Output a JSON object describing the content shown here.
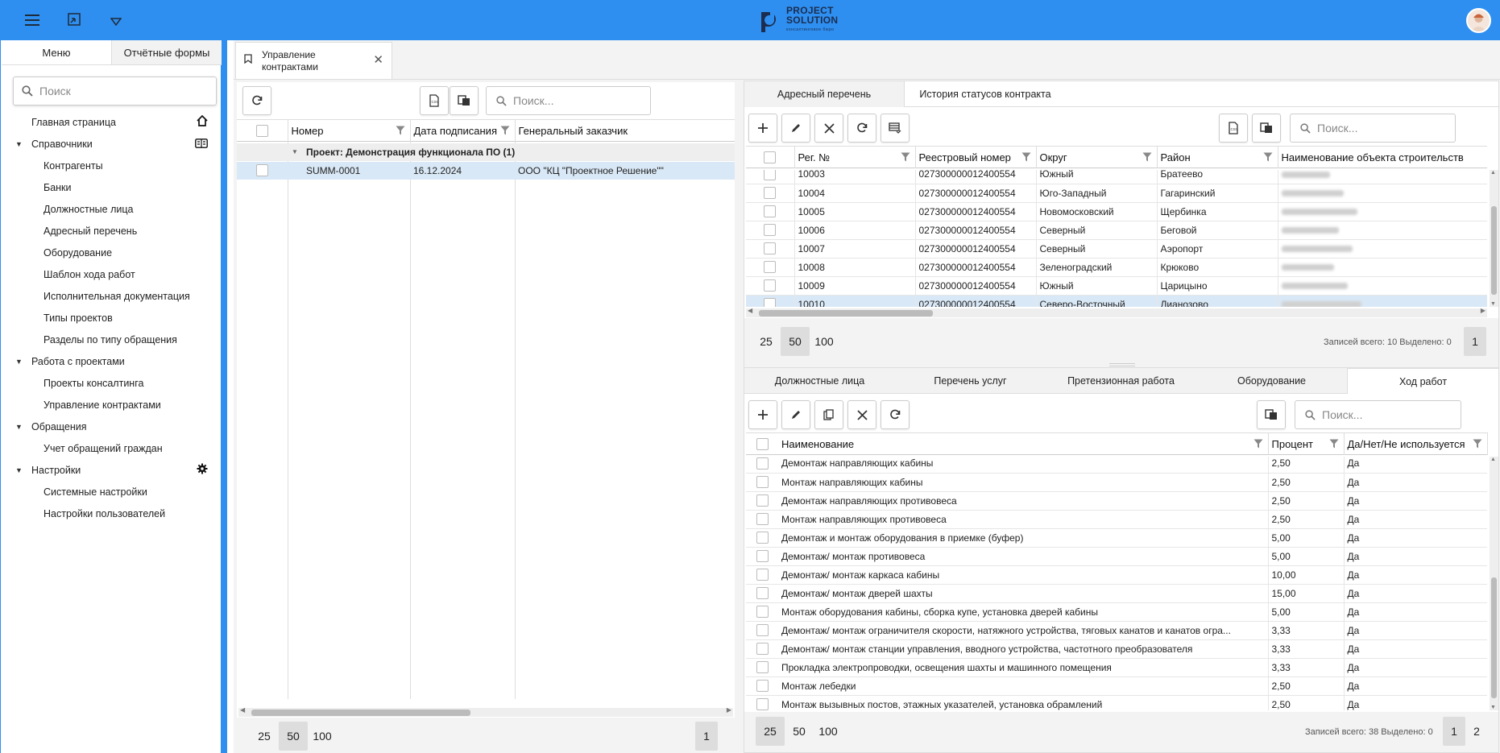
{
  "logo": {
    "line1": "PROJECT",
    "line2": "SOLUTION",
    "line3": "консалтинговое бюро"
  },
  "sidebar": {
    "tabs": [
      "Меню",
      "Отчётные формы"
    ],
    "search_placeholder": "Поиск",
    "items": [
      {
        "label": "Главная страница",
        "level": 0,
        "icon": "home-icon"
      },
      {
        "label": "Справочники",
        "level": 0,
        "expandable": true,
        "icon": "book-icon"
      },
      {
        "label": "Контрагенты",
        "level": 1
      },
      {
        "label": "Банки",
        "level": 1
      },
      {
        "label": "Должностные лица",
        "level": 1
      },
      {
        "label": "Адресный перечень",
        "level": 1
      },
      {
        "label": "Оборудование",
        "level": 1
      },
      {
        "label": "Шаблон хода работ",
        "level": 1
      },
      {
        "label": "Исполнительная документация",
        "level": 1
      },
      {
        "label": "Типы проектов",
        "level": 1
      },
      {
        "label": "Разделы по типу обращения",
        "level": 1
      },
      {
        "label": "Работа с проектами",
        "level": 0,
        "expandable": true
      },
      {
        "label": "Проекты консалтинга",
        "level": 1
      },
      {
        "label": "Управление контрактами",
        "level": 1
      },
      {
        "label": "Обращения",
        "level": 0,
        "expandable": true
      },
      {
        "label": "Учет обращений граждан",
        "level": 1
      },
      {
        "label": "Настройки",
        "level": 0,
        "expandable": true,
        "icon": "gear-icon"
      },
      {
        "label": "Системные настройки",
        "level": 1
      },
      {
        "label": "Настройки пользователей",
        "level": 1
      }
    ]
  },
  "doc_tab": {
    "label": "Управление контрактами"
  },
  "contracts": {
    "search_placeholder": "Поиск...",
    "columns": [
      "Номер",
      "Дата подписания",
      "Генеральный заказчик"
    ],
    "group_label": "Проект: Демонстрация функционала ПО (1)",
    "rows": [
      {
        "number": "SUMM-0001",
        "date": "16.12.2024",
        "customer": "ООО \"КЦ \"Проектное Решение\"\""
      }
    ],
    "pager": {
      "sizes": [
        "25",
        "50",
        "100"
      ],
      "active_size": "50",
      "pages": [
        "1"
      ]
    }
  },
  "address": {
    "tabs": [
      "Адресный перечень",
      "История статусов контракта"
    ],
    "search_placeholder": "Поиск...",
    "columns": [
      "Рег. №",
      "Реестровый номер",
      "Округ",
      "Район",
      "Наименование объекта строительств"
    ],
    "rows": [
      {
        "reg": "10003",
        "registry": "027300000012400554",
        "district": "Южный",
        "area": "Братеево"
      },
      {
        "reg": "10004",
        "registry": "027300000012400554",
        "district": "Юго-Западный",
        "area": "Гагаринский"
      },
      {
        "reg": "10005",
        "registry": "027300000012400554",
        "district": "Новомосковский",
        "area": "Щербинка"
      },
      {
        "reg": "10006",
        "registry": "027300000012400554",
        "district": "Северный",
        "area": "Беговой"
      },
      {
        "reg": "10007",
        "registry": "027300000012400554",
        "district": "Северный",
        "area": "Аэропорт"
      },
      {
        "reg": "10008",
        "registry": "027300000012400554",
        "district": "Зеленоградский",
        "area": "Крюково"
      },
      {
        "reg": "10009",
        "registry": "027300000012400554",
        "district": "Южный",
        "area": "Царицыно"
      },
      {
        "reg": "10010",
        "registry": "027300000012400554",
        "district": "Северо-Восточный",
        "area": "Лианозово"
      }
    ],
    "pager": {
      "sizes": [
        "25",
        "50",
        "100"
      ],
      "active_size": "50",
      "pages": [
        "1"
      ]
    },
    "stats": "Записей всего: 10 Выделено: 0"
  },
  "works": {
    "tabs": [
      "Должностные лица",
      "Перечень услуг",
      "Претензионная работа",
      "Оборудование",
      "Ход работ"
    ],
    "active_tab": "Ход работ",
    "search_placeholder": "Поиск...",
    "columns": [
      "Наименование",
      "Процент",
      "Да/Нет/Не используется"
    ],
    "rows": [
      {
        "name": "Демонтаж направляющих кабины",
        "pct": "2,50",
        "yn": "Да"
      },
      {
        "name": "Монтаж направляющих кабины",
        "pct": "2,50",
        "yn": "Да"
      },
      {
        "name": "Демонтаж направляющих противовеса",
        "pct": "2,50",
        "yn": "Да"
      },
      {
        "name": "Монтаж направляющих противовеса",
        "pct": "2,50",
        "yn": "Да"
      },
      {
        "name": "Демонтаж и монтаж оборудования в приемке (буфер)",
        "pct": "5,00",
        "yn": "Да"
      },
      {
        "name": "Демонтаж/ монтаж противовеса",
        "pct": "5,00",
        "yn": "Да"
      },
      {
        "name": "Демонтаж/ монтаж каркаса кабины",
        "pct": "10,00",
        "yn": "Да"
      },
      {
        "name": "Демонтаж/ монтаж дверей шахты",
        "pct": "15,00",
        "yn": "Да"
      },
      {
        "name": "Монтаж оборудования кабины, сборка купе, установка дверей кабины",
        "pct": "5,00",
        "yn": "Да"
      },
      {
        "name": "Демонтаж/ монтаж ограничителя скорости, натяжного устройства, тяговых канатов и канатов огра...",
        "pct": "3,33",
        "yn": "Да"
      },
      {
        "name": "Демонтаж/ монтаж станции управления, вводного устройства, частотного преобразователя",
        "pct": "3,33",
        "yn": "Да"
      },
      {
        "name": "Прокладка электропроводки, освещения шахты и машинного помещения",
        "pct": "3,33",
        "yn": "Да"
      },
      {
        "name": "Монтаж лебедки",
        "pct": "2,50",
        "yn": "Да"
      },
      {
        "name": "Монтаж вызывных постов, этажных указателей, установка обрамлений",
        "pct": "2,50",
        "yn": "Да"
      }
    ],
    "pager": {
      "sizes": [
        "25",
        "50",
        "100"
      ],
      "active_size": "25",
      "pages": [
        "1",
        "2"
      ]
    },
    "stats": "Записей всего: 38 Выделено: 0"
  },
  "colors": {
    "accent": "#2e8ff0",
    "selected_row": "#d9e8f6"
  }
}
